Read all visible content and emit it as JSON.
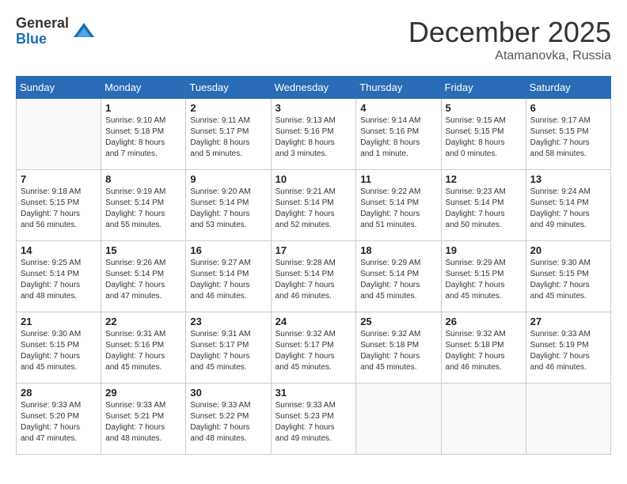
{
  "logo": {
    "general": "General",
    "blue": "Blue"
  },
  "title": "December 2025",
  "location": "Atamanovka, Russia",
  "days_of_week": [
    "Sunday",
    "Monday",
    "Tuesday",
    "Wednesday",
    "Thursday",
    "Friday",
    "Saturday"
  ],
  "weeks": [
    [
      {
        "day": "",
        "info": ""
      },
      {
        "day": "1",
        "info": "Sunrise: 9:10 AM\nSunset: 5:18 PM\nDaylight: 8 hours\nand 7 minutes."
      },
      {
        "day": "2",
        "info": "Sunrise: 9:11 AM\nSunset: 5:17 PM\nDaylight: 8 hours\nand 5 minutes."
      },
      {
        "day": "3",
        "info": "Sunrise: 9:13 AM\nSunset: 5:16 PM\nDaylight: 8 hours\nand 3 minutes."
      },
      {
        "day": "4",
        "info": "Sunrise: 9:14 AM\nSunset: 5:16 PM\nDaylight: 8 hours\nand 1 minute."
      },
      {
        "day": "5",
        "info": "Sunrise: 9:15 AM\nSunset: 5:15 PM\nDaylight: 8 hours\nand 0 minutes."
      },
      {
        "day": "6",
        "info": "Sunrise: 9:17 AM\nSunset: 5:15 PM\nDaylight: 7 hours\nand 58 minutes."
      }
    ],
    [
      {
        "day": "7",
        "info": "Sunrise: 9:18 AM\nSunset: 5:15 PM\nDaylight: 7 hours\nand 56 minutes."
      },
      {
        "day": "8",
        "info": "Sunrise: 9:19 AM\nSunset: 5:14 PM\nDaylight: 7 hours\nand 55 minutes."
      },
      {
        "day": "9",
        "info": "Sunrise: 9:20 AM\nSunset: 5:14 PM\nDaylight: 7 hours\nand 53 minutes."
      },
      {
        "day": "10",
        "info": "Sunrise: 9:21 AM\nSunset: 5:14 PM\nDaylight: 7 hours\nand 52 minutes."
      },
      {
        "day": "11",
        "info": "Sunrise: 9:22 AM\nSunset: 5:14 PM\nDaylight: 7 hours\nand 51 minutes."
      },
      {
        "day": "12",
        "info": "Sunrise: 9:23 AM\nSunset: 5:14 PM\nDaylight: 7 hours\nand 50 minutes."
      },
      {
        "day": "13",
        "info": "Sunrise: 9:24 AM\nSunset: 5:14 PM\nDaylight: 7 hours\nand 49 minutes."
      }
    ],
    [
      {
        "day": "14",
        "info": "Sunrise: 9:25 AM\nSunset: 5:14 PM\nDaylight: 7 hours\nand 48 minutes."
      },
      {
        "day": "15",
        "info": "Sunrise: 9:26 AM\nSunset: 5:14 PM\nDaylight: 7 hours\nand 47 minutes."
      },
      {
        "day": "16",
        "info": "Sunrise: 9:27 AM\nSunset: 5:14 PM\nDaylight: 7 hours\nand 46 minutes."
      },
      {
        "day": "17",
        "info": "Sunrise: 9:28 AM\nSunset: 5:14 PM\nDaylight: 7 hours\nand 46 minutes."
      },
      {
        "day": "18",
        "info": "Sunrise: 9:29 AM\nSunset: 5:14 PM\nDaylight: 7 hours\nand 45 minutes."
      },
      {
        "day": "19",
        "info": "Sunrise: 9:29 AM\nSunset: 5:15 PM\nDaylight: 7 hours\nand 45 minutes."
      },
      {
        "day": "20",
        "info": "Sunrise: 9:30 AM\nSunset: 5:15 PM\nDaylight: 7 hours\nand 45 minutes."
      }
    ],
    [
      {
        "day": "21",
        "info": "Sunrise: 9:30 AM\nSunset: 5:15 PM\nDaylight: 7 hours\nand 45 minutes."
      },
      {
        "day": "22",
        "info": "Sunrise: 9:31 AM\nSunset: 5:16 PM\nDaylight: 7 hours\nand 45 minutes."
      },
      {
        "day": "23",
        "info": "Sunrise: 9:31 AM\nSunset: 5:17 PM\nDaylight: 7 hours\nand 45 minutes."
      },
      {
        "day": "24",
        "info": "Sunrise: 9:32 AM\nSunset: 5:17 PM\nDaylight: 7 hours\nand 45 minutes."
      },
      {
        "day": "25",
        "info": "Sunrise: 9:32 AM\nSunset: 5:18 PM\nDaylight: 7 hours\nand 45 minutes."
      },
      {
        "day": "26",
        "info": "Sunrise: 9:32 AM\nSunset: 5:18 PM\nDaylight: 7 hours\nand 46 minutes."
      },
      {
        "day": "27",
        "info": "Sunrise: 9:33 AM\nSunset: 5:19 PM\nDaylight: 7 hours\nand 46 minutes."
      }
    ],
    [
      {
        "day": "28",
        "info": "Sunrise: 9:33 AM\nSunset: 5:20 PM\nDaylight: 7 hours\nand 47 minutes."
      },
      {
        "day": "29",
        "info": "Sunrise: 9:33 AM\nSunset: 5:21 PM\nDaylight: 7 hours\nand 48 minutes."
      },
      {
        "day": "30",
        "info": "Sunrise: 9:33 AM\nSunset: 5:22 PM\nDaylight: 7 hours\nand 48 minutes."
      },
      {
        "day": "31",
        "info": "Sunrise: 9:33 AM\nSunset: 5:23 PM\nDaylight: 7 hours\nand 49 minutes."
      },
      {
        "day": "",
        "info": ""
      },
      {
        "day": "",
        "info": ""
      },
      {
        "day": "",
        "info": ""
      }
    ]
  ]
}
